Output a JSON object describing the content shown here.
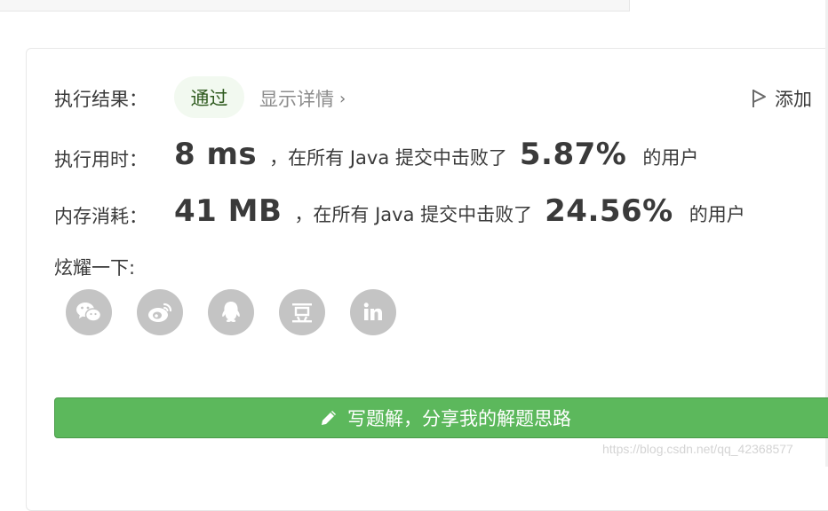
{
  "result": {
    "label": "执行结果：",
    "status": "通过",
    "details_link": "显示详情",
    "add_note": "添加"
  },
  "runtime": {
    "label": "执行用时：",
    "value": "8 ms",
    "text": "，在所有 Java 提交中击败了",
    "percent": "5.87%",
    "suffix": "的用户"
  },
  "memory": {
    "label": "内存消耗：",
    "value": "41 MB",
    "text": "，在所有 Java 提交中击败了",
    "percent": "24.56%",
    "suffix": "的用户"
  },
  "share": {
    "label": "炫耀一下:",
    "icons": [
      "wechat-icon",
      "weibo-icon",
      "qq-icon",
      "douban-icon",
      "linkedin-icon"
    ]
  },
  "cta": {
    "label": "写题解，分享我的解题思路"
  },
  "watermark": "https://blog.csdn.net/qq_42368577",
  "colors": {
    "accent": "#5cb85c",
    "pass_bg": "#f2f9f0",
    "icon_gray": "#c4c4c4"
  }
}
